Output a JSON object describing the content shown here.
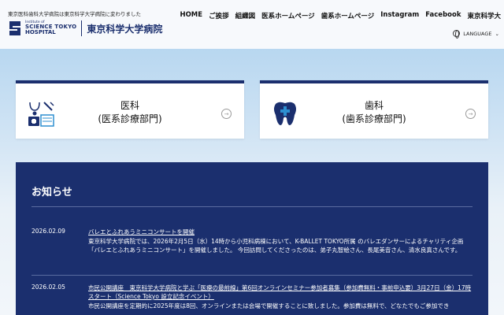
{
  "header": {
    "notice": "東京医科歯科大学病院は東京科学大学病院に変わりました",
    "logo_small": "Institute of",
    "logo_line1": "SCIENCE TOKYO",
    "logo_line2": "HOSPITAL",
    "logo_jp": "東京科学大学病院",
    "nav": [
      "HOME",
      "ご挨拶",
      "組織図",
      "医系ホームページ",
      "歯系ホームページ",
      "Instagram",
      "Facebook",
      "東京科学大"
    ],
    "language": "LANGUAGE"
  },
  "cards": {
    "medical": {
      "line1": "医科",
      "line2": "(医系診療部門)"
    },
    "dental": {
      "line1": "歯科",
      "line2": "(歯系診療部門)"
    }
  },
  "news": {
    "title": "お知らせ",
    "items": [
      {
        "date": "2026.02.09",
        "headline": "バレエとふれあうミニコンサートを開催",
        "desc": "東京科学大学病院では、2026年2月5日（水）14時から小児科病棟において、K-BALLET TOKYO所属 のバレエダンサーによるチャリティ企画「バレエとふれあうミニコンサート」を開催しました。 今回訪問してくださったのは、弟子丸智絵さん、長尾美音さん、清水良真さんです。"
      },
      {
        "date": "2026.02.05",
        "headline": "市民公開講座　東京科学大学病院と学ぶ「医療の最前線」第6回オンラインセミナー参加者募集（参加費無料・事前申込要）3月27日（金）17時スタート（Science Tokyo 設立記念イベント）",
        "desc": "市民公開講座を定期的に2025年度は8回、オンラインまたは会場で開催することに致しました。参加費は無料で、どなたでもご参加でき"
      }
    ]
  },
  "colors": {
    "brand": "#1b2f6e",
    "hero_top": "#b8d7f0"
  }
}
